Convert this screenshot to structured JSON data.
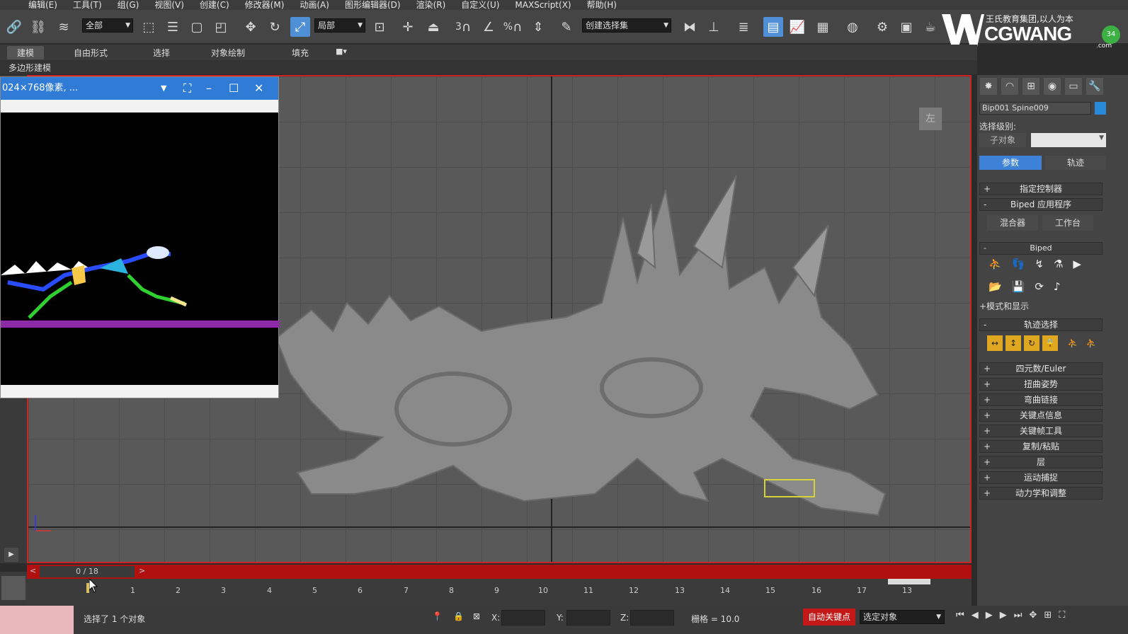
{
  "menu": [
    "编辑(E)",
    "工具(T)",
    "组(G)",
    "视图(V)",
    "创建(C)",
    "修改器(M)",
    "动画(A)",
    "图形编辑器(D)",
    "渲染(R)",
    "自定义(U)",
    "MAXScript(X)",
    "帮助(H)"
  ],
  "toolbar": {
    "filter_dropdown": "全部",
    "coord_dropdown": "局部",
    "selection_set": "创建选择集",
    "snap_3": "3",
    "percent_snap": "%"
  },
  "logo": {
    "tagline": "王氏教育集团,以人为本",
    "brand": "CGWANG",
    "suffix": ".com",
    "badge": "34"
  },
  "ribbon": {
    "tabs": [
      "建模",
      "自由形式",
      "选择",
      "对象绘制",
      "填充"
    ],
    "sub_label": "多边形建模"
  },
  "float_window": {
    "title": "024×768像素, ..."
  },
  "viewport": {
    "viewcube_label": "左"
  },
  "command_panel": {
    "object_name": "Bip001 Spine009",
    "selection_level_label": "选择级别:",
    "sub_object_label": "子对象",
    "tab_params": "参数",
    "tab_track": "轨迹",
    "rollouts_top": [
      {
        "sign": "+",
        "label": "指定控制器"
      },
      {
        "sign": "-",
        "label": "Biped 应用程序"
      }
    ],
    "mixer_button": "混合器",
    "workbench_button": "工作台",
    "biped_rollout": "Biped",
    "mode_display": "+模式和显示",
    "track_select_rollout": "轨迹选择",
    "rollouts_bottom": [
      {
        "sign": "+",
        "label": "四元数/Euler"
      },
      {
        "sign": "+",
        "label": "扭曲姿势"
      },
      {
        "sign": "+",
        "label": "弯曲链接"
      },
      {
        "sign": "+",
        "label": "关键点信息"
      },
      {
        "sign": "+",
        "label": "关键帧工具"
      },
      {
        "sign": "+",
        "label": "复制/粘贴"
      },
      {
        "sign": "+",
        "label": "层"
      },
      {
        "sign": "+",
        "label": "运动捕捉"
      },
      {
        "sign": "+",
        "label": "动力学和调整"
      }
    ]
  },
  "timeline": {
    "frame_display": "0 / 18",
    "prev": "<",
    "next": ">",
    "ticks": [
      "1",
      "2",
      "3",
      "4",
      "5",
      "6",
      "7",
      "8",
      "9",
      "10",
      "11",
      "12",
      "13",
      "14",
      "15",
      "16",
      "17",
      "13"
    ]
  },
  "status": {
    "message": "选择了 1 个对象",
    "x_label": "X:",
    "y_label": "Y:",
    "z_label": "Z:",
    "grid_label": "栅格 = 10.0",
    "auto_key": "自动关键点",
    "selected_object": "选定对象"
  }
}
